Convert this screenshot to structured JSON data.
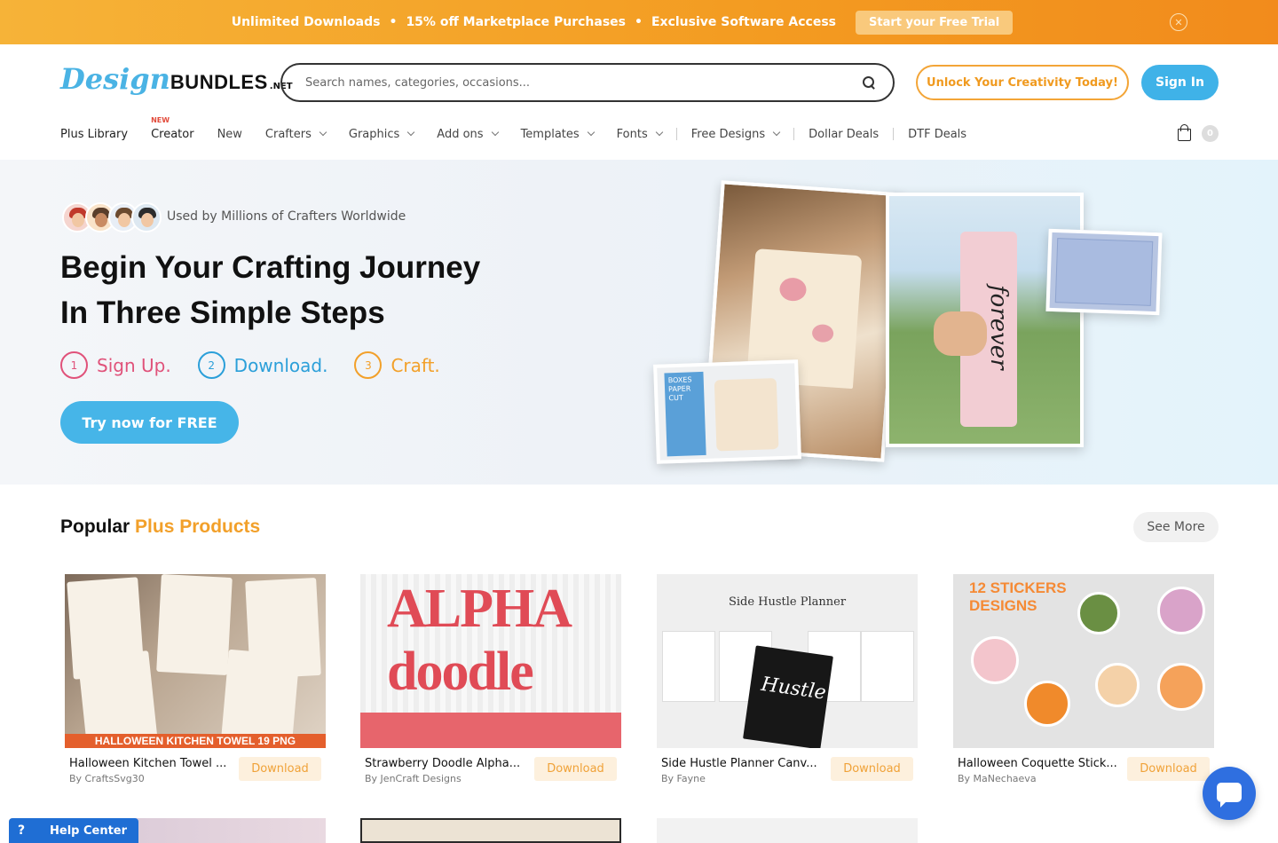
{
  "promo": {
    "item1": "Unlimited Downloads",
    "item2": "15% off Marketplace Purchases",
    "item3": "Exclusive Software Access",
    "dot": "•",
    "cta": "Start your Free Trial",
    "close_glyph": "✕"
  },
  "header": {
    "logo": {
      "part1": "Design",
      "part2": "BUNDLES",
      "part3": ".NET"
    },
    "search_placeholder": "Search names, categories, occasions...",
    "unlock": "Unlock Your Creativity Today!",
    "signin": "Sign In",
    "cart_count": "0"
  },
  "nav": {
    "items": [
      {
        "label": "Plus Library"
      },
      {
        "label": "Creator",
        "tag": "NEW"
      },
      {
        "label": "New"
      },
      {
        "label": "Crafters"
      },
      {
        "label": "Graphics"
      },
      {
        "label": "Add ons"
      },
      {
        "label": "Templates"
      },
      {
        "label": "Fonts"
      },
      {
        "label": "Free Designs"
      },
      {
        "label": "Dollar Deals"
      },
      {
        "label": "DTF Deals"
      }
    ]
  },
  "hero": {
    "used_by": "Used by Millions of Crafters Worldwide",
    "headline_line1": "Begin Your Crafting Journey",
    "headline_line2": "In Three Simple Steps",
    "steps": [
      {
        "num": "1",
        "label": "Sign Up.",
        "color": "#e0527a"
      },
      {
        "num": "2",
        "label": "Download.",
        "color": "#2b9fd9"
      },
      {
        "num": "3",
        "label": "Craft.",
        "color": "#f2a02a"
      }
    ],
    "cta": "Try now for FREE",
    "small_photo_label": "BOXES PAPER CUT"
  },
  "popular": {
    "title_part1": "Popular",
    "title_part2": "Plus Products",
    "see_more": "See More",
    "products": [
      {
        "title": "Halloween Kitchen Towel ...",
        "author": "By CraftsSvg30",
        "action": "Download",
        "thumb_text": "HALLOWEEN KITCHEN TOWEL 19 PNG"
      },
      {
        "title": "Strawberry Doodle Alpha...",
        "author": "By JenCraft Designs",
        "action": "Download",
        "thumb_text": "ALPHA doodle"
      },
      {
        "title": "Side Hustle Planner Canv...",
        "author": "By Fayne",
        "action": "Download",
        "thumb_text": "Side Hustle Planner"
      },
      {
        "title": "Halloween Coquette Stick...",
        "author": "By MaNechaeva",
        "action": "Download",
        "thumb_text": "12 STICKERS DESIGNS"
      }
    ]
  },
  "help": {
    "icon": "?",
    "label": "Help Center"
  },
  "colors": {
    "accent_orange": "#f2a02a",
    "accent_blue": "#3fb2e8",
    "help_blue": "#1f6ed4"
  }
}
